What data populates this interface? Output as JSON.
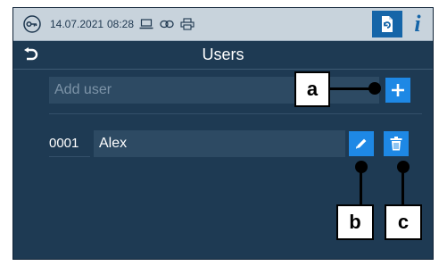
{
  "statusbar": {
    "date": "14.07.2021",
    "time": "08:28",
    "icons": [
      "key-icon",
      "laptop-icon",
      "link-icon",
      "printer-icon",
      "document-sync-icon",
      "info-icon"
    ],
    "info_label": "i"
  },
  "header": {
    "title": "Users",
    "back_icon": "back-arrow-icon"
  },
  "add_user": {
    "placeholder": "Add user",
    "button_icon": "plus-icon"
  },
  "users": [
    {
      "id": "0001",
      "name": "Alex",
      "edit_icon": "pencil-icon",
      "delete_icon": "trash-icon"
    }
  ],
  "callouts": {
    "a": "a",
    "b": "b",
    "c": "c"
  },
  "colors": {
    "screen_bg": "#1e3a53",
    "statusbar_bg": "#c8d3dc",
    "accent_blue": "#1e88e5",
    "field_bg": "#2d4a63"
  }
}
